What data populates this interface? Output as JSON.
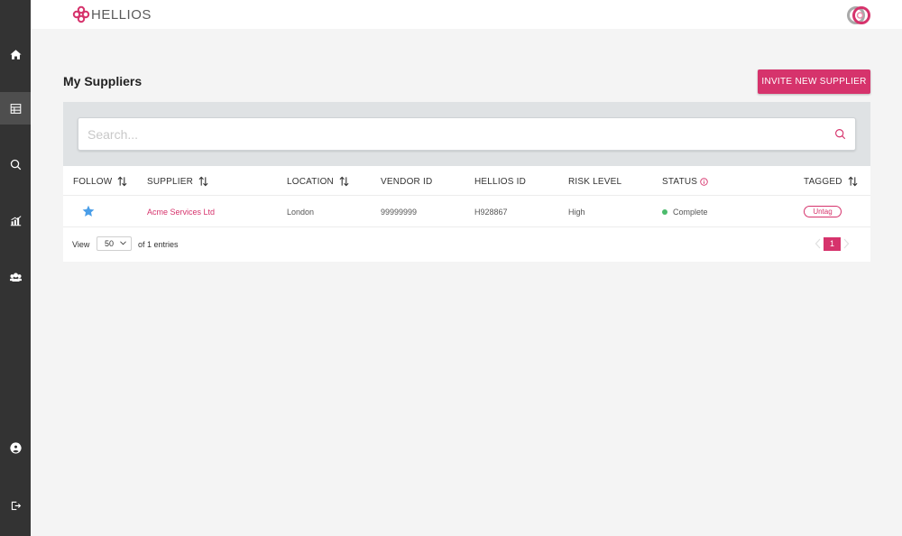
{
  "app": {
    "logo_text": "HELLIOS",
    "brand_color": "#d6336c"
  },
  "sidebar": {
    "items": [
      {
        "icon": "home-icon"
      },
      {
        "icon": "table-icon",
        "active": true
      },
      {
        "icon": "search-icon"
      },
      {
        "icon": "chart-icon"
      },
      {
        "icon": "users-icon"
      },
      {
        "icon": "account-icon"
      },
      {
        "icon": "logout-icon"
      }
    ]
  },
  "page": {
    "title": "My Suppliers",
    "invite_label": "INVITE NEW SUPPLIER"
  },
  "search": {
    "placeholder": "Search...",
    "value": ""
  },
  "table": {
    "columns": [
      "FOLLOW",
      "SUPPLIER",
      "LOCATION",
      "VENDOR ID",
      "HELLIOS ID",
      "RISK LEVEL",
      "STATUS",
      "TAGGED"
    ],
    "rows": [
      {
        "followed": true,
        "supplier": "Acme Services Ltd",
        "location": "London",
        "vendor_id": "99999999",
        "hellios_id": "H928867",
        "risk_level": "High",
        "status": "Complete",
        "status_color": "#4cbb6c",
        "tag_action": "Untag"
      }
    ]
  },
  "footer": {
    "view_label": "View",
    "page_size": "50",
    "entries_label": "of 1 entries",
    "current_page": "1"
  }
}
